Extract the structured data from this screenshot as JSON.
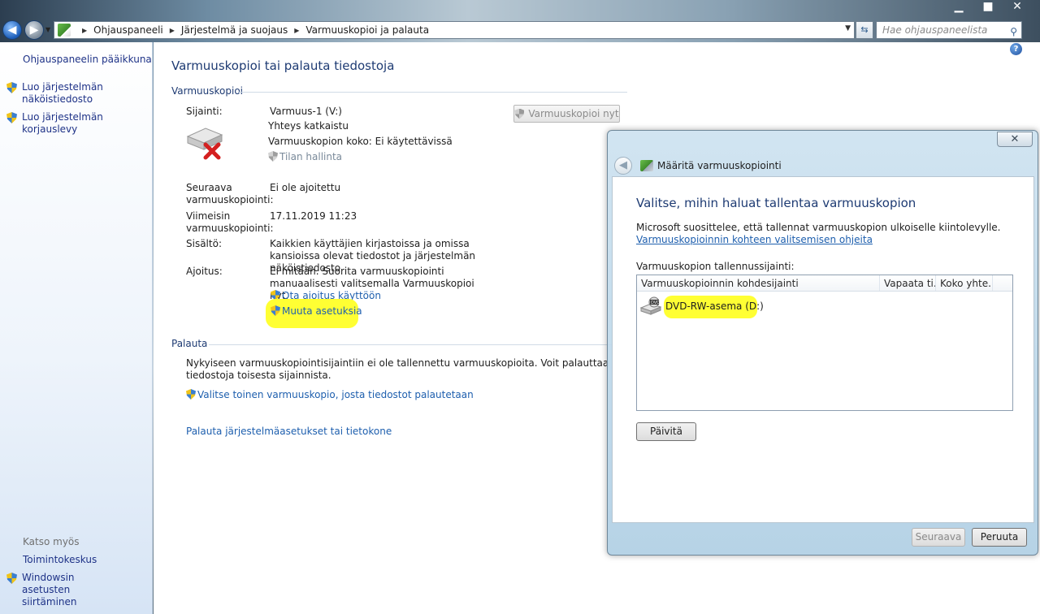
{
  "window": {
    "minimize": "▁",
    "maximize": "■",
    "close": "✕"
  },
  "address_bar": {
    "crumbs": [
      "Ohjauspaneeli",
      "Järjestelmä ja suojaus",
      "Varmuuskopioi ja palauta"
    ],
    "search_placeholder": "Hae ohjauspaneelista"
  },
  "left_pane": {
    "home": "Ohjauspaneelin pääikkuna",
    "tasks": [
      "Luo järjestelmän näköistiedosto",
      "Luo järjestelmän korjauslevy"
    ],
    "see_also_heading": "Katso myös",
    "see_also": [
      "Toimintokeskus",
      "Windowsin asetusten siirtäminen"
    ]
  },
  "main": {
    "title": "Varmuuskopioi tai palauta tiedostoja",
    "backup_section": "Varmuuskopioi",
    "location_label": "Sijainti:",
    "location_value": "Varmuus-1 (V:)",
    "status": "Yhteys katkaistu",
    "size": "Varmuuskopion koko: Ei käytettävissä",
    "manage_space": "Tilan hallinta",
    "backup_now": "Varmuuskopioi nyt",
    "next_backup_label": "Seuraava varmuuskopiointi:",
    "next_backup_value": "Ei ole ajoitettu",
    "last_backup_label": "Viimeisin varmuuskopiointi:",
    "last_backup_value": "17.11.2019 11:23",
    "contents_label": "Sisältö:",
    "contents_value": "Kaikkien käyttäjien kirjastoissa ja omissa kansioissa olevat tiedostot ja järjestelmän näköistiedosto",
    "schedule_label": "Ajoitus:",
    "schedule_value": "Ei mitään. Suorita varmuuskopiointi manuaalisesti valitsemalla Varmuuskopioi nyt.",
    "enable_schedule": "Ota ajoitus käyttöön",
    "change_settings": "Muuta asetuksia",
    "restore_section": "Palauta",
    "restore_text": "Nykyiseen varmuuskopiointisijaintiin ei ole tallennettu varmuuskopioita. Voit palauttaa tiedostoja toisesta sijainnista.",
    "select_other_backup": "Valitse toinen varmuuskopio, josta tiedostot palautetaan",
    "restore_system": "Palauta järjestelmäasetukset tai tietokone"
  },
  "dialog": {
    "close": "✕",
    "title": "Määritä varmuuskopiointi",
    "heading": "Valitse, mihin haluat tallentaa varmuuskopion",
    "intro": "Microsoft suosittelee, että tallennat varmuuskopion ulkoiselle kiintolevylle.",
    "intro_link": "Varmuuskopioinnin kohteen valitsemisen ohjeita",
    "location_label": "Varmuuskopion tallennussijainti:",
    "columns": [
      "Varmuuskopioinnin kohdesijainti",
      "Vapaata ti...",
      "Koko yhte..."
    ],
    "destinations": [
      {
        "name": "DVD-RW-asema (D:)",
        "free": "",
        "total": ""
      }
    ],
    "refresh": "Päivitä",
    "next": "Seuraava",
    "cancel": "Peruuta"
  }
}
